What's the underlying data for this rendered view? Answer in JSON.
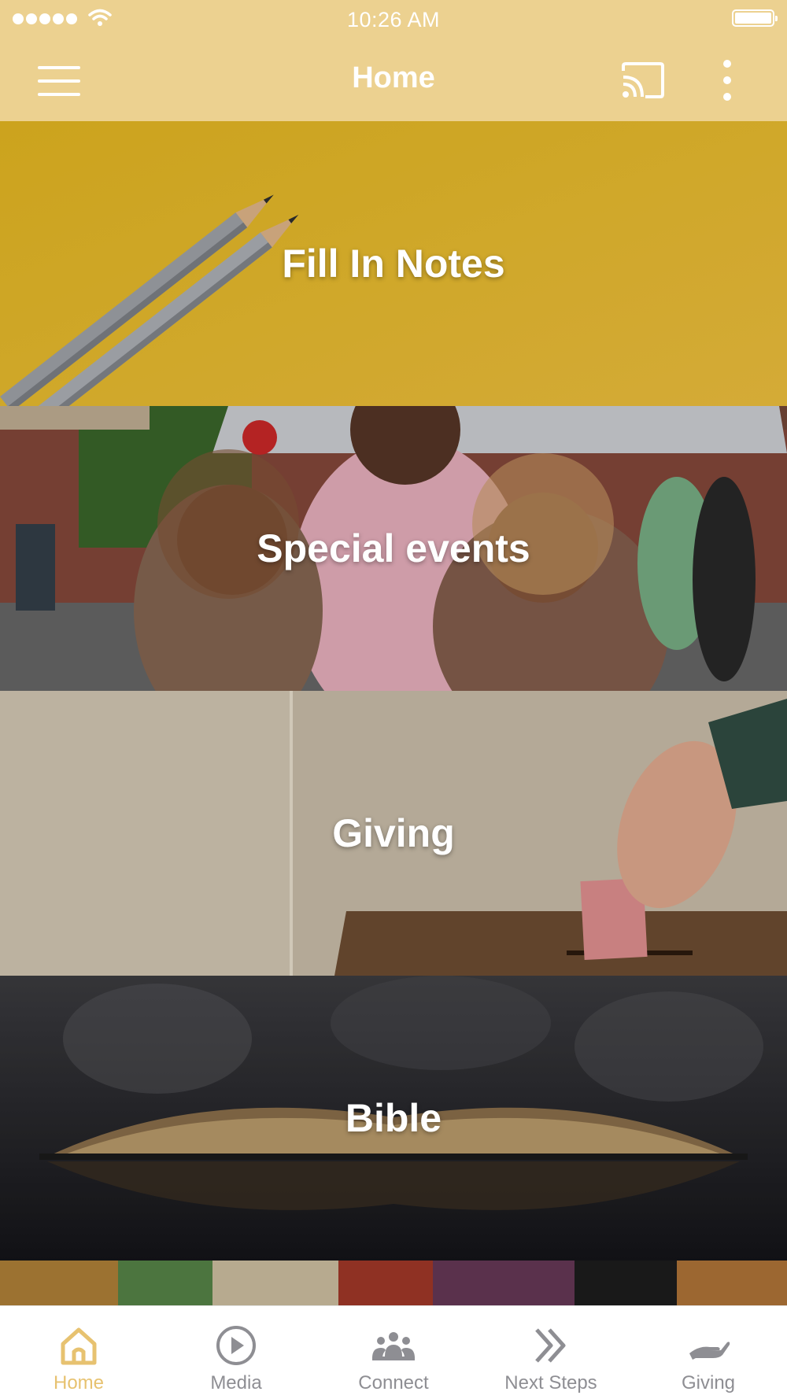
{
  "status_bar": {
    "time": "10:26 AM"
  },
  "nav": {
    "title": "Home"
  },
  "tiles": [
    {
      "label": "Fill In Notes"
    },
    {
      "label": "Special events"
    },
    {
      "label": "Giving"
    },
    {
      "label": "Bible"
    }
  ],
  "tabs": [
    {
      "label": "Home",
      "icon": "home-icon",
      "active": true
    },
    {
      "label": "Media",
      "icon": "play-icon",
      "active": false
    },
    {
      "label": "Connect",
      "icon": "group-icon",
      "active": false
    },
    {
      "label": "Next Steps",
      "icon": "double-chevron-icon",
      "active": false
    },
    {
      "label": "Giving",
      "icon": "giving-hand-icon",
      "active": false
    }
  ],
  "colors": {
    "header": "#ecd190",
    "active_tab": "#e7c270",
    "inactive_tab": "#8e8e93"
  }
}
